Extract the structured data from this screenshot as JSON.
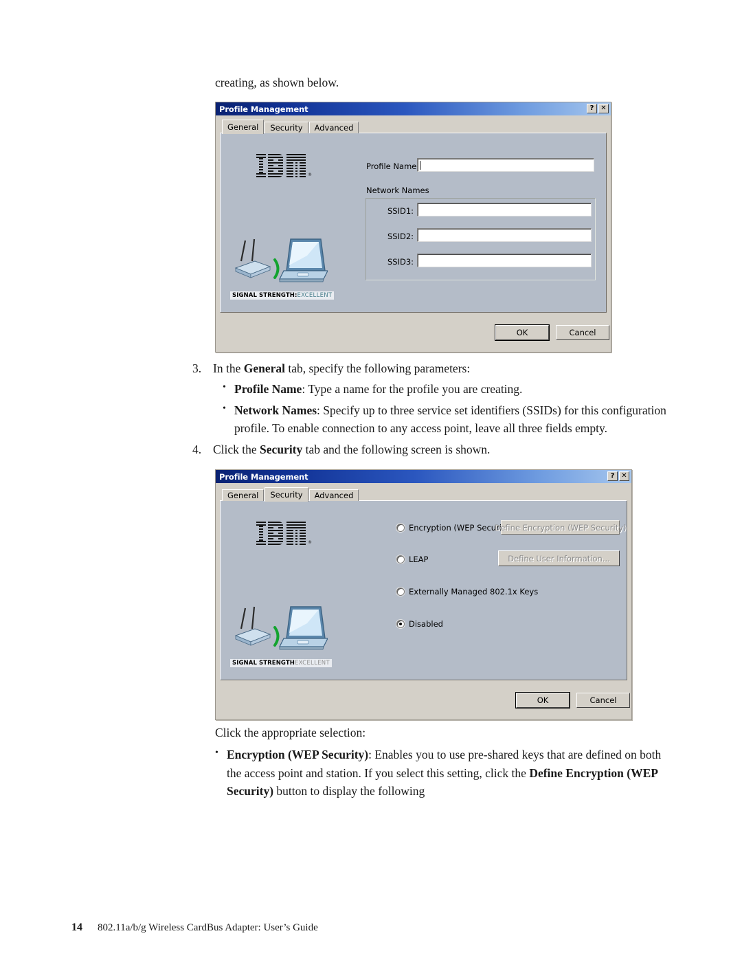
{
  "page": {
    "intro_text": "creating, as shown below.",
    "footer": {
      "page_number": "14",
      "running_title": "802.11a/b/g Wireless CardBus Adapter: User’s Guide"
    }
  },
  "steps": {
    "step3": {
      "number": "3.",
      "lead_pre": "In the ",
      "lead_bold": "General",
      "lead_post": " tab, specify the following parameters:",
      "bullets": [
        {
          "bold": "Profile Name",
          "rest": ": Type a name for the profile you are creating."
        },
        {
          "bold": "Network Names",
          "rest": ": Specify up to three service set identifiers (SSIDs) for this configuration profile. To enable connection to any access point, leave all three fields empty."
        }
      ]
    },
    "step4": {
      "number": "4.",
      "lead_pre": "Click the ",
      "lead_bold": "Security",
      "lead_post": " tab and the following screen is shown."
    },
    "closing": {
      "lead": "Click the appropriate selection:",
      "bullet_bold": "Encryption (WEP Security)",
      "bullet_part1": ": Enables you to use pre-shared keys that are defined on both the access point and station. If you select this setting, click the ",
      "bullet_bold2": "Define Encryption (WEP Security)",
      "bullet_part2": " button to display the following"
    }
  },
  "dialog_general": {
    "title": "Profile Management",
    "titlebar_buttons": [
      {
        "name": "help-button",
        "glyph": "?"
      },
      {
        "name": "close-button",
        "glyph": "✕"
      }
    ],
    "tabs": [
      {
        "label": "General",
        "active": true
      },
      {
        "label": "Security",
        "active": false
      },
      {
        "label": "Advanced",
        "active": false
      }
    ],
    "brand": "IBM",
    "brand_reg": "®",
    "signal_label": "SIGNAL STRENGTH:",
    "signal_value": "EXCELLENT",
    "profile_name_label": "Profile Name:",
    "profile_name_value": "",
    "network_names_label": "Network Names",
    "ssid_fields": [
      {
        "label": "SSID1:",
        "value": ""
      },
      {
        "label": "SSID2:",
        "value": ""
      },
      {
        "label": "SSID3:",
        "value": ""
      }
    ],
    "buttons": [
      {
        "label": "OK",
        "default": true
      },
      {
        "label": "Cancel",
        "default": false
      }
    ]
  },
  "dialog_security": {
    "title": "Profile Management",
    "titlebar_buttons": [
      {
        "name": "help-button",
        "glyph": "?"
      },
      {
        "name": "close-button",
        "glyph": "✕"
      }
    ],
    "tabs": [
      {
        "label": "General",
        "active": false
      },
      {
        "label": "Security",
        "active": true
      },
      {
        "label": "Advanced",
        "active": false
      }
    ],
    "brand": "IBM",
    "brand_reg": "®",
    "signal_label": "SIGNAL STRENGTH",
    "signal_value": "EXCELLENT",
    "options": [
      {
        "label": "Encryption (WEP Security)",
        "selected": false
      },
      {
        "label": "LEAP",
        "selected": false
      },
      {
        "label": "Externally Managed 802.1x Keys",
        "selected": false
      },
      {
        "label": "Disabled",
        "selected": true
      }
    ],
    "side_buttons": [
      {
        "label": "Define Encryption (WEP Security)",
        "disabled": true
      },
      {
        "label": "Define User Information...",
        "disabled": true
      }
    ],
    "buttons": [
      {
        "label": "OK",
        "default": true
      },
      {
        "label": "Cancel",
        "default": false
      }
    ]
  },
  "colors": {
    "title_start": "#0a2272",
    "title_end": "#a8c8ee",
    "dialog_face": "#d4d0c8",
    "pane_face": "#b4bcc8",
    "signal_value": "#4a7f8c",
    "signal_value_muted": "#8f8f8f"
  }
}
